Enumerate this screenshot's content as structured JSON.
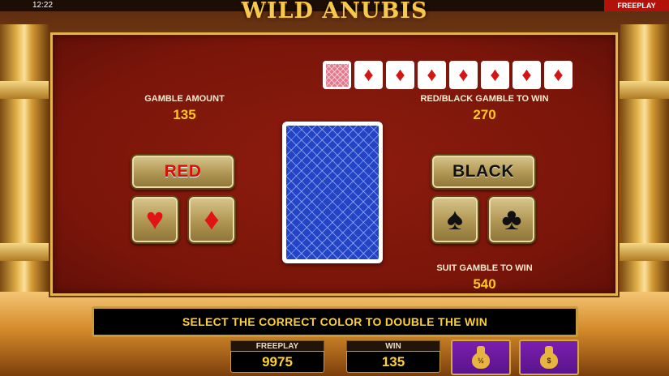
{
  "status_bar": {
    "time": "12:22",
    "mode": "FREEPLAY"
  },
  "game": {
    "logo_text": "WILD ANUBIS"
  },
  "history": {
    "cards": [
      {
        "type": "card-back"
      },
      {
        "type": "diamond",
        "symbol": "♦"
      },
      {
        "type": "diamond",
        "symbol": "♦"
      },
      {
        "type": "diamond",
        "symbol": "♦"
      },
      {
        "type": "diamond",
        "symbol": "♦"
      },
      {
        "type": "diamond",
        "symbol": "♦"
      },
      {
        "type": "diamond",
        "symbol": "♦"
      },
      {
        "type": "diamond",
        "symbol": "♦"
      }
    ]
  },
  "gamble": {
    "amount_label": "GAMBLE AMOUNT",
    "amount_value": "135",
    "color_win_label": "RED/BLACK GAMBLE TO WIN",
    "color_win_value": "270",
    "suit_win_label": "SUIT GAMBLE TO WIN",
    "suit_win_value": "540"
  },
  "buttons": {
    "red_label": "RED",
    "black_label": "BLACK",
    "hearts_symbol": "♥",
    "diamonds_symbol": "♦",
    "spades_symbol": "♠",
    "clubs_symbol": "♣",
    "half_bag_label": "½",
    "full_bag_label": "$"
  },
  "message": "SELECT THE CORRECT COLOR TO DOUBLE THE WIN",
  "meters": {
    "freeplay_label": "FREEPLAY",
    "freeplay_value": "9975",
    "win_label": "WIN",
    "win_value": "135"
  },
  "colors": {
    "panel": "#7a150a",
    "accent_gold": "#ffc91f",
    "card_back": "#2344c4",
    "purple_button": "#6a18a0"
  }
}
